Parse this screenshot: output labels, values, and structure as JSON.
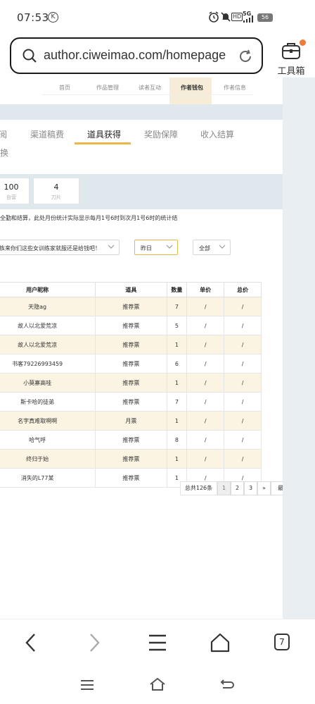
{
  "status": {
    "time": "07:53",
    "k_badge": "K",
    "hd": "HD",
    "net": "5G",
    "battery": "56"
  },
  "browser": {
    "url": "author.ciweimao.com/homepage",
    "toolbox_label": "工具箱",
    "tab_count": "7"
  },
  "site_nav": {
    "items": [
      "首页",
      "作品管理",
      "读者互动",
      "作者钱包",
      "作者信息"
    ],
    "active_index": 3
  },
  "tabs": {
    "items": [
      "阅",
      "渠道稿费",
      "道具获得",
      "奖励保障",
      "收入结算"
    ],
    "second_row": "换",
    "active": "道具获得"
  },
  "stats": [
    {
      "value": "100",
      "label": "台营"
    },
    {
      "value": "4",
      "label": "刀片"
    }
  ],
  "note": "全勤和结算，此处月份统计实际显示每月1号6时到次月1号6时的统计结",
  "filters": {
    "book": "族来你们这些女训练家就服还是给钱吧！",
    "date": "昨日",
    "type": "全部"
  },
  "table": {
    "headers": [
      "用户昵称",
      "道具",
      "数量",
      "单价",
      "总价"
    ],
    "rows": [
      [
        "天隐ag",
        "推荐票",
        "7",
        "/",
        "/"
      ],
      [
        "故人以北爱荒凉",
        "推荐票",
        "5",
        "/",
        "/"
      ],
      [
        "故人以北爱荒凉",
        "推荐票",
        "1",
        "/",
        "/"
      ],
      [
        "书客79226993459",
        "推荐票",
        "6",
        "/",
        "/"
      ],
      [
        "小莫寨高哇",
        "推荐票",
        "1",
        "/",
        "/"
      ],
      [
        "斯卡哈的徒弟",
        "推荐票",
        "7",
        "/",
        "/"
      ],
      [
        "名字真难取啊啊",
        "月票",
        "1",
        "/",
        "/"
      ],
      [
        "哈气呼",
        "推荐票",
        "8",
        "/",
        "/"
      ],
      [
        "终归于始",
        "推荐票",
        "1",
        "/",
        "/"
      ],
      [
        "消失的L77某",
        "推荐票",
        "1",
        "/",
        "/"
      ]
    ]
  },
  "pagination": {
    "total": "总共126条",
    "pages": [
      "1",
      "2",
      "3"
    ],
    "next": "»",
    "last": "最"
  },
  "colors": {
    "accent": "#e8b948",
    "row_tint": "#fcf4e2",
    "strip": "#dfe8ec",
    "notification_dot": "#f07a3a"
  }
}
